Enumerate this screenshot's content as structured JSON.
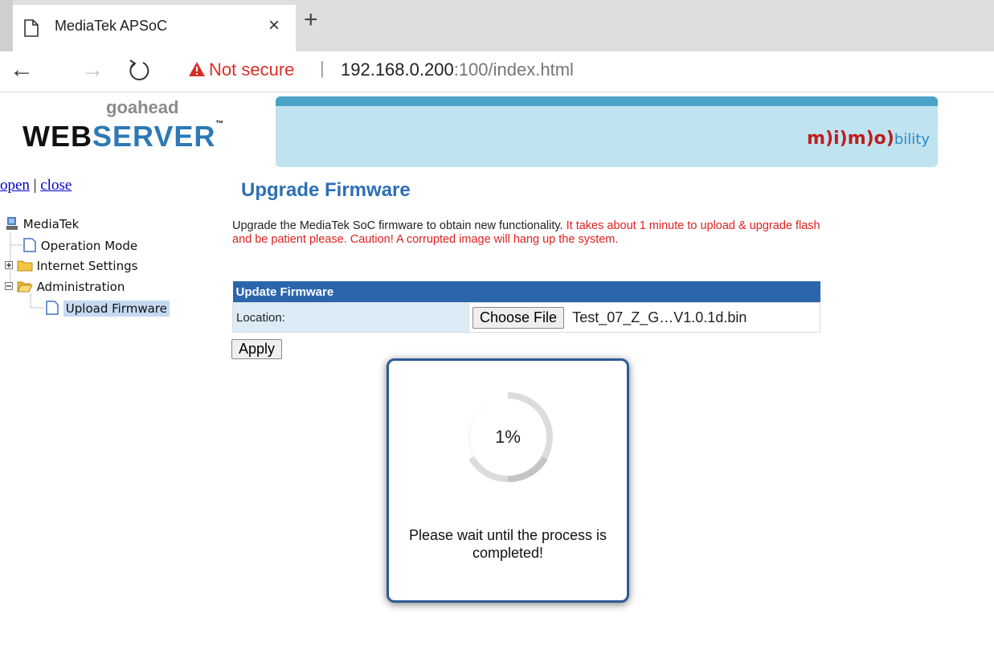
{
  "browser": {
    "tab_title": "MediaTek APSoC",
    "tab_close": "×",
    "new_tab": "+",
    "back": "←",
    "forward": "→",
    "not_secure": "Not secure",
    "separator": "|",
    "url_host": "192.168.0.200",
    "url_rest": ":100/index.html"
  },
  "header": {
    "logo_small": "goahead",
    "logo_web": "WEB",
    "logo_server": "SERVER",
    "logo_tm": "™",
    "banner_logo": "m)i)m)o)",
    "banner_suffix": "bility"
  },
  "sidebar": {
    "open": "open",
    "pipe": "|",
    "close": "close",
    "tree": [
      {
        "label": "MediaTek",
        "icon": "computer-icon"
      },
      {
        "label": "Operation Mode",
        "icon": "page-icon"
      },
      {
        "label": "Internet Settings",
        "icon": "folder-icon"
      },
      {
        "label": "Administration",
        "icon": "folder-open-icon"
      },
      {
        "label": "Upload Firmware",
        "icon": "page-icon",
        "selected": true
      }
    ]
  },
  "main": {
    "title": "Upgrade Firmware",
    "desc_normal": "Upgrade the MediaTek SoC firmware to obtain new functionality. ",
    "desc_warn": "It takes about 1 minute to upload & upgrade flash and be patient please. Caution! A corrupted image will hang up the system.",
    "table_header": "Update Firmware",
    "location_label": "Location:",
    "choose_file": "Choose File",
    "file_name": "Test_07_Z_G…V1.0.1d.bin",
    "apply": "Apply"
  },
  "modal": {
    "percent": "1%",
    "progress": 0.01,
    "message": "Please wait until the process is completed!"
  },
  "colors": {
    "header_blue": "#2b66ad",
    "title_blue": "#2e6fb5",
    "warn_red": "#e02020",
    "modal_border": "#2d5a96"
  }
}
